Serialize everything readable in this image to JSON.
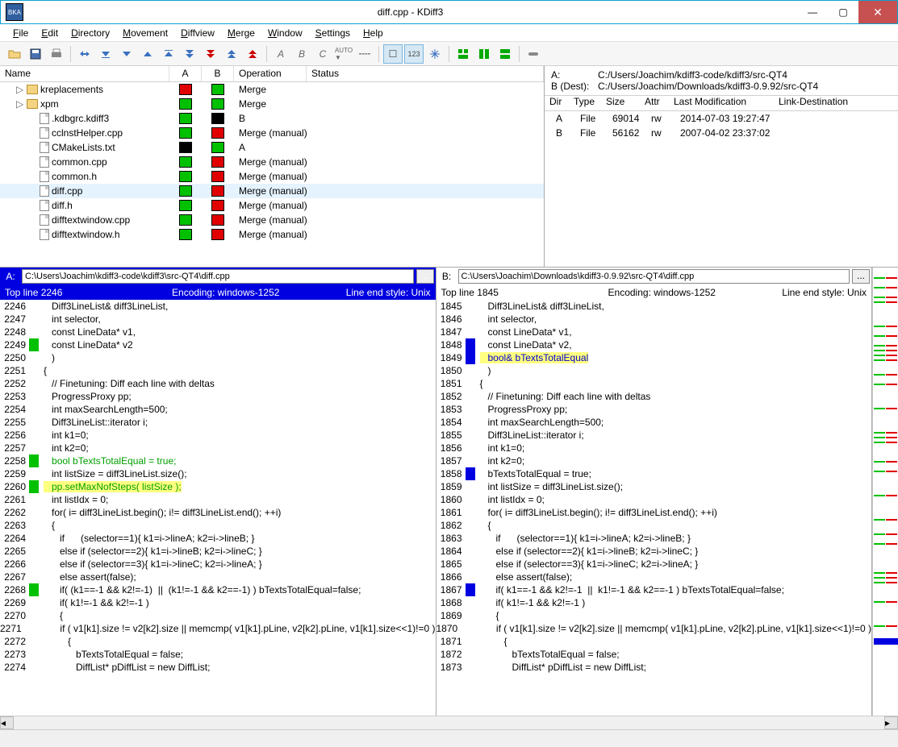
{
  "window": {
    "title": "diff.cpp - KDiff3",
    "icon_text": "BKA"
  },
  "menu": [
    "File",
    "Edit",
    "Directory",
    "Movement",
    "Diffview",
    "Merge",
    "Window",
    "Settings",
    "Help"
  ],
  "tree": {
    "headers": {
      "name": "Name",
      "a": "A",
      "b": "B",
      "op": "Operation",
      "status": "Status"
    },
    "rows": [
      {
        "indent": 1,
        "tri": "▷",
        "icon": "folder",
        "name": "kreplacements",
        "a": "red",
        "b": "green",
        "op": "Merge"
      },
      {
        "indent": 1,
        "tri": "▷",
        "icon": "folder",
        "name": "xpm",
        "a": "green",
        "b": "green",
        "op": "Merge"
      },
      {
        "indent": 2,
        "icon": "file",
        "name": ".kdbgrc.kdiff3",
        "a": "green",
        "b": "black",
        "op": "B"
      },
      {
        "indent": 2,
        "icon": "file",
        "name": "cclnstHelper.cpp",
        "a": "green",
        "b": "red",
        "op": "Merge (manual)"
      },
      {
        "indent": 2,
        "icon": "file",
        "name": "CMakeLists.txt",
        "a": "black",
        "b": "green",
        "op": "A"
      },
      {
        "indent": 2,
        "icon": "file",
        "name": "common.cpp",
        "a": "green",
        "b": "red",
        "op": "Merge (manual)"
      },
      {
        "indent": 2,
        "icon": "file",
        "name": "common.h",
        "a": "green",
        "b": "red",
        "op": "Merge (manual)"
      },
      {
        "indent": 2,
        "icon": "file",
        "name": "diff.cpp",
        "a": "green",
        "b": "red",
        "op": "Merge (manual)",
        "sel": true
      },
      {
        "indent": 2,
        "icon": "file",
        "name": "diff.h",
        "a": "green",
        "b": "red",
        "op": "Merge (manual)"
      },
      {
        "indent": 2,
        "icon": "file",
        "name": "difftextwindow.cpp",
        "a": "green",
        "b": "red",
        "op": "Merge (manual)"
      },
      {
        "indent": 2,
        "icon": "file",
        "name": "difftextwindow.h",
        "a": "green",
        "b": "red",
        "op": "Merge (manual)"
      }
    ]
  },
  "info": {
    "a_label": "A:",
    "a_path": "C:/Users/Joachim/kdiff3-code/kdiff3/src-QT4",
    "b_label": "B (Dest):",
    "b_path": "C:/Users/Joachim/Downloads/kdiff3-0.9.92/src-QT4",
    "headers": {
      "dir": "Dir",
      "type": "Type",
      "size": "Size",
      "attr": "Attr",
      "mod": "Last Modification",
      "link": "Link-Destination"
    },
    "rows": [
      {
        "dir": "A",
        "type": "File",
        "size": "69014",
        "attr": "rw",
        "mod": "2014-07-03 19:27:47"
      },
      {
        "dir": "B",
        "type": "File",
        "size": "56162",
        "attr": "rw",
        "mod": "2007-04-02 23:37:02"
      }
    ]
  },
  "paneA": {
    "label": "A:",
    "path": "C:\\Users\\Joachim\\kdiff3-code\\kdiff3\\src-QT4\\diff.cpp",
    "topline": "Top line 2246",
    "encoding": "Encoding: windows-1252",
    "lineend": "Line end style: Unix",
    "lines": [
      {
        "n": "2246",
        "t": "   Diff3LineList& diff3LineList,"
      },
      {
        "n": "2247",
        "t": "   int selector,"
      },
      {
        "n": "2248",
        "t": "   const LineData* v1,"
      },
      {
        "n": "2249",
        "mk": "g",
        "t": "   const LineData* v2"
      },
      {
        "n": "",
        "mk": "g",
        "t": ""
      },
      {
        "n": "2250",
        "t": "   )"
      },
      {
        "n": "2251",
        "t": "{"
      },
      {
        "n": "2252",
        "t": "   // Finetuning: Diff each line with deltas"
      },
      {
        "n": "2253",
        "t": "   ProgressProxy pp;"
      },
      {
        "n": "2254",
        "t": "   int maxSearchLength=500;"
      },
      {
        "n": "2255",
        "t": "   Diff3LineList::iterator i;"
      },
      {
        "n": "2256",
        "t": "   int k1=0;"
      },
      {
        "n": "2257",
        "t": "   int k2=0;"
      },
      {
        "n": "2258",
        "mk": "g",
        "cls": "diff-g",
        "t": "   bool bTextsTotalEqual = true;",
        "kw": "bool"
      },
      {
        "n": "2259",
        "t": "   int listSize = diff3LineList.size();"
      },
      {
        "n": "2260",
        "mk": "g",
        "cls": "diff-g hl",
        "t": "   pp.setMaxNofSteps( listSize );"
      },
      {
        "n": "2261",
        "t": "   int listIdx = 0;"
      },
      {
        "n": "2262",
        "t": "   for( i= diff3LineList.begin(); i!= diff3LineList.end(); ++i)"
      },
      {
        "n": "2263",
        "t": "   {"
      },
      {
        "n": "2264",
        "t": "      if      (selector==1){ k1=i->lineA; k2=i->lineB; }"
      },
      {
        "n": "2265",
        "t": "      else if (selector==2){ k1=i->lineB; k2=i->lineC; }"
      },
      {
        "n": "2266",
        "t": "      else if (selector==3){ k1=i->lineC; k2=i->lineA; }"
      },
      {
        "n": "2267",
        "t": "      else assert(false);"
      },
      {
        "n": "2268",
        "mk": "g",
        "t": "      if( (k1==-1 && k2!=-1)  ||  (k1!=-1 && k2==-1) ) bTextsTotalEqual=false;"
      },
      {
        "n": "2269",
        "t": "      if( k1!=-1 && k2!=-1 )"
      },
      {
        "n": "2270",
        "t": "      {"
      },
      {
        "n": "2271",
        "t": "         if ( v1[k1].size != v2[k2].size || memcmp( v1[k1].pLine, v2[k2].pLine, v1[k1].size<<1)!=0 )"
      },
      {
        "n": "2272",
        "t": "         {"
      },
      {
        "n": "2273",
        "t": "            bTextsTotalEqual = false;"
      },
      {
        "n": "2274",
        "t": "            DiffList* pDiffList = new DiffList;"
      }
    ]
  },
  "paneB": {
    "label": "B:",
    "path": "C:\\Users\\Joachim\\Downloads\\kdiff3-0.9.92\\src-QT4\\diff.cpp",
    "topline": "Top line 1845",
    "encoding": "Encoding: windows-1252",
    "lineend": "Line end style: Unix",
    "lines": [
      {
        "n": "1845",
        "t": "   Diff3LineList& diff3LineList,"
      },
      {
        "n": "1846",
        "t": "   int selector,"
      },
      {
        "n": "1847",
        "t": "   const LineData* v1,"
      },
      {
        "n": "1848",
        "mk": "b",
        "t": "   const LineData* v2,",
        "diffpart": ","
      },
      {
        "n": "1849",
        "mk": "b",
        "cls": "diff-b hl",
        "t": "   bool& bTextsTotalEqual"
      },
      {
        "n": "1850",
        "t": "   )"
      },
      {
        "n": "1851",
        "t": "{"
      },
      {
        "n": "1852",
        "t": "   // Finetuning: Diff each line with deltas"
      },
      {
        "n": "1853",
        "t": "   ProgressProxy pp;"
      },
      {
        "n": "1854",
        "t": "   int maxSearchLength=500;"
      },
      {
        "n": "1855",
        "t": "   Diff3LineList::iterator i;"
      },
      {
        "n": "1856",
        "t": "   int k1=0;"
      },
      {
        "n": "1857",
        "t": "   int k2=0;"
      },
      {
        "n": "1858",
        "mk": "b",
        "t": "   bTextsTotalEqual = true;"
      },
      {
        "n": "1859",
        "t": "   int listSize = diff3LineList.size();"
      },
      {
        "n": "",
        "mk": "b",
        "t": ""
      },
      {
        "n": "1860",
        "t": "   int listIdx = 0;"
      },
      {
        "n": "1861",
        "t": "   for( i= diff3LineList.begin(); i!= diff3LineList.end(); ++i)"
      },
      {
        "n": "1862",
        "t": "   {"
      },
      {
        "n": "1863",
        "t": "      if      (selector==1){ k1=i->lineA; k2=i->lineB; }"
      },
      {
        "n": "1864",
        "t": "      else if (selector==2){ k1=i->lineB; k2=i->lineC; }"
      },
      {
        "n": "1865",
        "t": "      else if (selector==3){ k1=i->lineC; k2=i->lineA; }"
      },
      {
        "n": "1866",
        "t": "      else assert(false);"
      },
      {
        "n": "1867",
        "mk": "b",
        "t": "      if( k1==-1 && k2!=-1  ||  k1!=-1 && k2==-1 ) bTextsTotalEqual=false;"
      },
      {
        "n": "1868",
        "t": "      if( k1!=-1 && k2!=-1 )"
      },
      {
        "n": "1869",
        "t": "      {"
      },
      {
        "n": "1870",
        "t": "         if ( v1[k1].size != v2[k2].size || memcmp( v1[k1].pLine, v2[k2].pLine, v1[k1].size<<1)!=0 )"
      },
      {
        "n": "1871",
        "t": "         {"
      },
      {
        "n": "1872",
        "t": "            bTextsTotalEqual = false;"
      },
      {
        "n": "1873",
        "t": "            DiffList* pDiffList = new DiffList;"
      }
    ]
  }
}
